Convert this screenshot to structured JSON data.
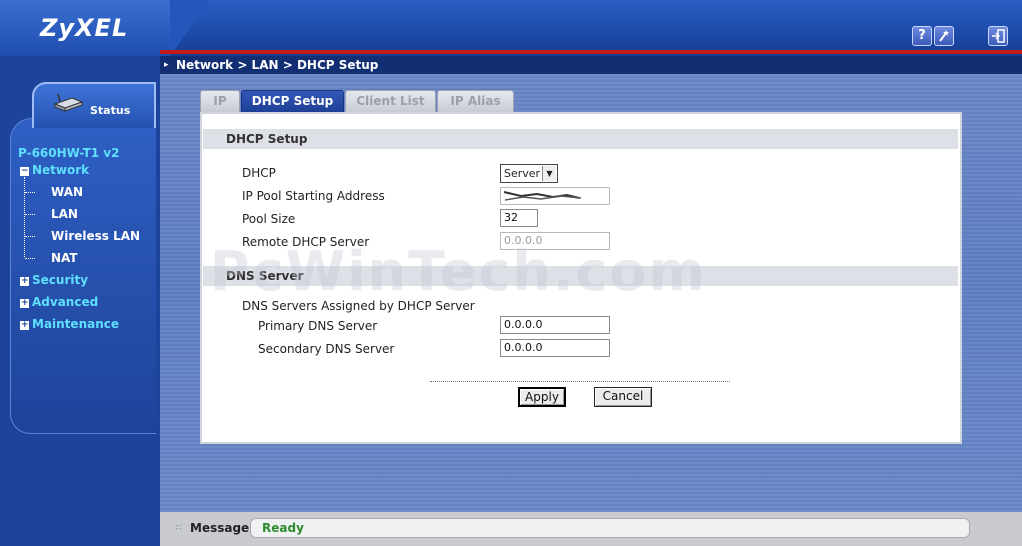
{
  "header": {
    "logo": "ZyXEL",
    "help_icon": "?",
    "wizard_icon": "wizard-icon",
    "logout_icon": "logout-icon"
  },
  "breadcrumb": "Network > LAN > DHCP Setup",
  "sidebar": {
    "status_label": "Status",
    "model": "P-660HW-T1 v2",
    "network_label": "Network",
    "network_items": [
      "WAN",
      "LAN",
      "Wireless LAN",
      "NAT"
    ],
    "security_label": "Security",
    "advanced_label": "Advanced",
    "maintenance_label": "Maintenance"
  },
  "tabs": [
    "IP",
    "DHCP Setup",
    "Client List",
    "IP Alias"
  ],
  "active_tab": "DHCP Setup",
  "dhcp_setup": {
    "section_title": "DHCP Setup",
    "dhcp_label": "DHCP",
    "dhcp_value": "Server",
    "pool_start_label": "IP Pool Starting Address",
    "pool_size_label": "Pool Size",
    "pool_size_value": "32",
    "remote_label": "Remote DHCP Server",
    "remote_value": "0.0.0.0"
  },
  "dns_server": {
    "section_title": "DNS Server",
    "assigned_label": "DNS Servers Assigned by DHCP Server",
    "primary_label": "Primary DNS Server",
    "primary_value": "0.0.0.0",
    "secondary_label": "Secondary DNS Server",
    "secondary_value": "0.0.0.0"
  },
  "buttons": {
    "apply": "Apply",
    "cancel": "Cancel"
  },
  "message": {
    "label": "Message",
    "value": "Ready"
  },
  "watermark": "PcWinTech.com",
  "colors": {
    "header_blue": "#1c4aa8",
    "accent_red": "#c41a1a",
    "nav_cyan": "#5fe0ff",
    "active_tab": "#2a4ca6",
    "ready_green": "#2d8c2d"
  }
}
